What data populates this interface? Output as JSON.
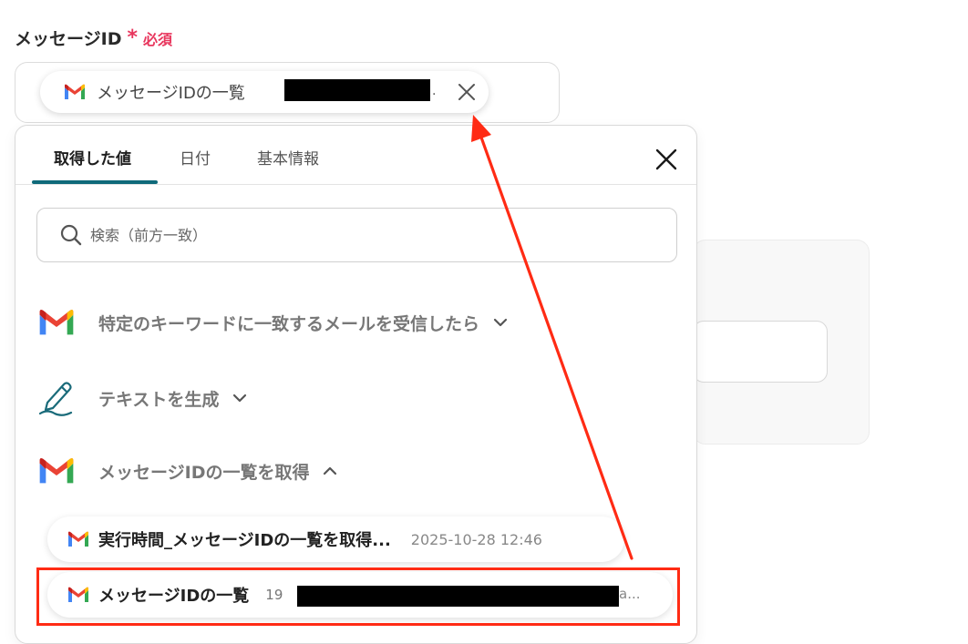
{
  "field": {
    "label": "メッセージID",
    "required_star": "*",
    "required_text": "必須"
  },
  "chip": {
    "label": "メッセージIDの一覧",
    "trailing": "."
  },
  "dropdown": {
    "tabs": [
      {
        "label": "取得した値",
        "active": true
      },
      {
        "label": "日付",
        "active": false
      },
      {
        "label": "基本情報",
        "active": false
      }
    ],
    "search_placeholder": "検索（前方一致）",
    "sections": [
      {
        "label": "特定のキーワードに一致するメールを受信したら",
        "icon": "gmail-icon",
        "expanded": false
      },
      {
        "label": "テキストを生成",
        "icon": "pen-icon",
        "expanded": false
      },
      {
        "label": "メッセージIDの一覧を取得",
        "icon": "gmail-icon",
        "expanded": true
      }
    ],
    "items": [
      {
        "label": "実行時間_メッセージIDの一覧を取得...",
        "time": "2025-10-28 12:46"
      },
      {
        "label": "メッセージIDの一覧",
        "prefix": "19",
        "suffix": "a..."
      }
    ]
  },
  "colors": {
    "accent": "#0f6a7a",
    "required": "#e8365d",
    "highlight": "#ff2b14"
  }
}
